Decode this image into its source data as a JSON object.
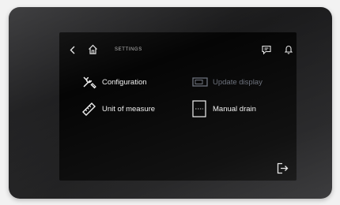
{
  "header": {
    "title": "SETTINGS",
    "back_icon": "chevron-left-icon",
    "home_icon": "home-icon",
    "message_icon": "chat-bubble-icon",
    "alarm_icon": "bell-icon"
  },
  "menu": {
    "items": [
      {
        "label": "Configuration",
        "icon": "tools-icon",
        "enabled": true
      },
      {
        "label": "Update display",
        "icon": "display-icon",
        "enabled": false
      },
      {
        "label": "Unit of measure",
        "icon": "ruler-icon",
        "enabled": true
      },
      {
        "label": "Manual drain",
        "icon": "drain-icon",
        "enabled": true
      }
    ]
  },
  "footer": {
    "logout_icon": "logout-icon"
  },
  "colors": {
    "screen_background": "#050505",
    "text": "#f0f0f0",
    "disabled_text": "#6a6f7a"
  }
}
